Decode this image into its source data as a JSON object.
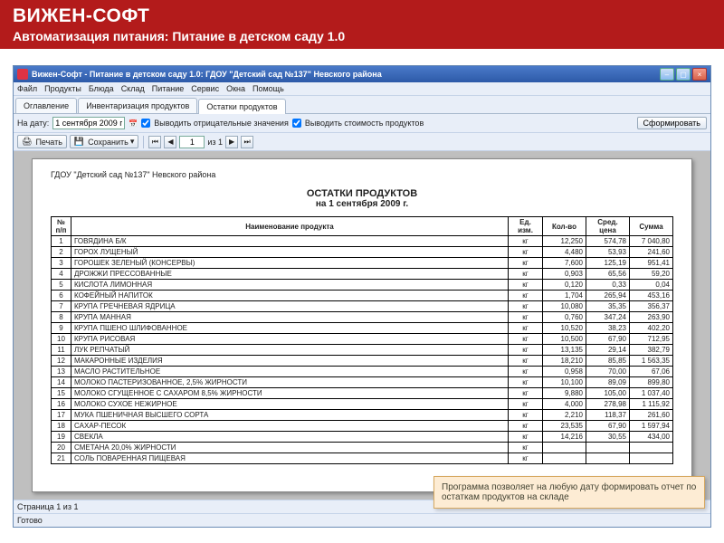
{
  "header": {
    "brand": "ВИЖЕН-СОФТ",
    "subtitle": "Автоматизация питания: Питание в детском саду 1.0"
  },
  "window": {
    "title": "Вижен-Софт - Питание в детском саду 1.0: ГДОУ \"Детский сад №137\" Невского района"
  },
  "menu": [
    "Файл",
    "Продукты",
    "Блюда",
    "Склад",
    "Питание",
    "Сервис",
    "Окна",
    "Помощь"
  ],
  "tabs": [
    {
      "label": "Оглавление",
      "active": false
    },
    {
      "label": "Инвентаризация продуктов",
      "active": false
    },
    {
      "label": "Остатки продуктов",
      "active": true
    }
  ],
  "toolbar": {
    "date_label": "На дату:",
    "date_value": "1 сентября 2009 г.",
    "check1_label": "Выводить отрицательные значения",
    "check1": true,
    "check2_label": "Выводить стоимость продуктов",
    "check2": true,
    "generate": "Сформировать"
  },
  "toolbar2": {
    "print": "Печать",
    "save": "Сохранить",
    "page_value": "1",
    "page_of": "из 1"
  },
  "report": {
    "org": "ГДОУ \"Детский сад №137\" Невского района",
    "title": "ОСТАТКИ ПРОДУКТОВ",
    "date": "на 1 сентября 2009 г.",
    "columns": [
      "№ п/п",
      "Наименование продукта",
      "Ед. изм.",
      "Кол-во",
      "Сред. цена",
      "Сумма"
    ],
    "rows": [
      [
        "1",
        "ГОВЯДИНА Б/К",
        "кг",
        "12,250",
        "574,78",
        "7 040,80"
      ],
      [
        "2",
        "ГОРОХ ЛУЩЕНЫЙ",
        "кг",
        "4,480",
        "53,93",
        "241,60"
      ],
      [
        "3",
        "ГОРОШЕК ЗЕЛЕНЫЙ (КОНСЕРВЫ)",
        "кг",
        "7,600",
        "125,19",
        "951,41"
      ],
      [
        "4",
        "ДРОЖЖИ ПРЕССОВАННЫЕ",
        "кг",
        "0,903",
        "65,56",
        "59,20"
      ],
      [
        "5",
        "КИСЛОТА ЛИМОННАЯ",
        "кг",
        "0,120",
        "0,33",
        "0,04"
      ],
      [
        "6",
        "КОФЕЙНЫЙ НАПИТОК",
        "кг",
        "1,704",
        "265,94",
        "453,16"
      ],
      [
        "7",
        "КРУПА ГРЕЧНЕВАЯ ЯДРИЦА",
        "кг",
        "10,080",
        "35,35",
        "356,37"
      ],
      [
        "8",
        "КРУПА МАННАЯ",
        "кг",
        "0,760",
        "347,24",
        "263,90"
      ],
      [
        "9",
        "КРУПА ПШЕНО ШЛИФОВАННОЕ",
        "кг",
        "10,520",
        "38,23",
        "402,20"
      ],
      [
        "10",
        "КРУПА РИСОВАЯ",
        "кг",
        "10,500",
        "67,90",
        "712,95"
      ],
      [
        "11",
        "ЛУК РЕПЧАТЫЙ",
        "кг",
        "13,135",
        "29,14",
        "382,79"
      ],
      [
        "12",
        "МАКАРОННЫЕ ИЗДЕЛИЯ",
        "кг",
        "18,210",
        "85,85",
        "1 563,35"
      ],
      [
        "13",
        "МАСЛО РАСТИТЕЛЬНОЕ",
        "кг",
        "0,958",
        "70,00",
        "67,06"
      ],
      [
        "14",
        "МОЛОКО ПАСТЕРИЗОВАННОЕ, 2,5% ЖИРНОСТИ",
        "кг",
        "10,100",
        "89,09",
        "899,80"
      ],
      [
        "15",
        "МОЛОКО СГУЩЕННОЕ С САХАРОМ 8,5% ЖИРНОСТИ",
        "кг",
        "9,880",
        "105,00",
        "1 037,40"
      ],
      [
        "16",
        "МОЛОКО СУХОЕ НЕЖИРНОЕ",
        "кг",
        "4,000",
        "278,98",
        "1 115,92"
      ],
      [
        "17",
        "МУКА ПШЕНИЧНАЯ ВЫСШЕГО СОРТА",
        "кг",
        "2,210",
        "118,37",
        "261,60"
      ],
      [
        "18",
        "САХАР-ПЕСОК",
        "кг",
        "23,535",
        "67,90",
        "1 597,94"
      ],
      [
        "19",
        "СВЕКЛА",
        "кг",
        "14,216",
        "30,55",
        "434,00"
      ],
      [
        "20",
        "СМЕТАНА 20,0% ЖИРНОСТИ",
        "кг",
        "",
        "",
        ""
      ],
      [
        "21",
        "СОЛЬ ПОВАРЕННАЯ ПИЩЕВАЯ",
        "кг",
        "",
        "",
        ""
      ]
    ]
  },
  "status": {
    "page": "Страница 1 из 1",
    "ready": "Готово"
  },
  "callout": "Программа позволяет на любую дату формировать отчет по остаткам продуктов на складе"
}
